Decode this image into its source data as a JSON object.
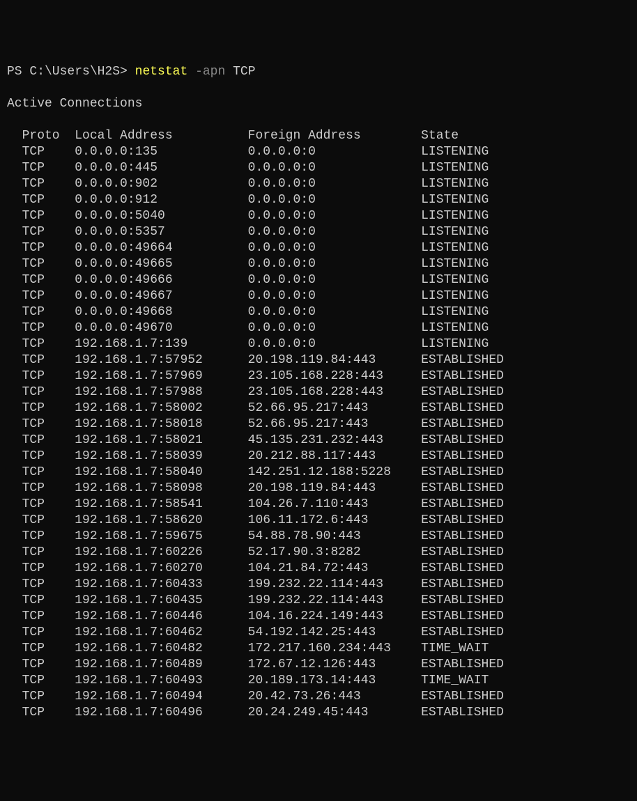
{
  "prompt": {
    "prefix": "PS C:\\Users\\H2S> ",
    "command": "netstat",
    "flag": "-apn",
    "arg": "TCP"
  },
  "section_title": "Active Connections",
  "columns": {
    "proto": "Proto",
    "local": "Local Address",
    "foreign": "Foreign Address",
    "state": "State"
  },
  "rows": [
    {
      "proto": "TCP",
      "local": "0.0.0.0:135",
      "foreign": "0.0.0.0:0",
      "state": "LISTENING"
    },
    {
      "proto": "TCP",
      "local": "0.0.0.0:445",
      "foreign": "0.0.0.0:0",
      "state": "LISTENING"
    },
    {
      "proto": "TCP",
      "local": "0.0.0.0:902",
      "foreign": "0.0.0.0:0",
      "state": "LISTENING"
    },
    {
      "proto": "TCP",
      "local": "0.0.0.0:912",
      "foreign": "0.0.0.0:0",
      "state": "LISTENING"
    },
    {
      "proto": "TCP",
      "local": "0.0.0.0:5040",
      "foreign": "0.0.0.0:0",
      "state": "LISTENING"
    },
    {
      "proto": "TCP",
      "local": "0.0.0.0:5357",
      "foreign": "0.0.0.0:0",
      "state": "LISTENING"
    },
    {
      "proto": "TCP",
      "local": "0.0.0.0:49664",
      "foreign": "0.0.0.0:0",
      "state": "LISTENING"
    },
    {
      "proto": "TCP",
      "local": "0.0.0.0:49665",
      "foreign": "0.0.0.0:0",
      "state": "LISTENING"
    },
    {
      "proto": "TCP",
      "local": "0.0.0.0:49666",
      "foreign": "0.0.0.0:0",
      "state": "LISTENING"
    },
    {
      "proto": "TCP",
      "local": "0.0.0.0:49667",
      "foreign": "0.0.0.0:0",
      "state": "LISTENING"
    },
    {
      "proto": "TCP",
      "local": "0.0.0.0:49668",
      "foreign": "0.0.0.0:0",
      "state": "LISTENING"
    },
    {
      "proto": "TCP",
      "local": "0.0.0.0:49670",
      "foreign": "0.0.0.0:0",
      "state": "LISTENING"
    },
    {
      "proto": "TCP",
      "local": "192.168.1.7:139",
      "foreign": "0.0.0.0:0",
      "state": "LISTENING"
    },
    {
      "proto": "TCP",
      "local": "192.168.1.7:57952",
      "foreign": "20.198.119.84:443",
      "state": "ESTABLISHED"
    },
    {
      "proto": "TCP",
      "local": "192.168.1.7:57969",
      "foreign": "23.105.168.228:443",
      "state": "ESTABLISHED"
    },
    {
      "proto": "TCP",
      "local": "192.168.1.7:57988",
      "foreign": "23.105.168.228:443",
      "state": "ESTABLISHED"
    },
    {
      "proto": "TCP",
      "local": "192.168.1.7:58002",
      "foreign": "52.66.95.217:443",
      "state": "ESTABLISHED"
    },
    {
      "proto": "TCP",
      "local": "192.168.1.7:58018",
      "foreign": "52.66.95.217:443",
      "state": "ESTABLISHED"
    },
    {
      "proto": "TCP",
      "local": "192.168.1.7:58021",
      "foreign": "45.135.231.232:443",
      "state": "ESTABLISHED"
    },
    {
      "proto": "TCP",
      "local": "192.168.1.7:58039",
      "foreign": "20.212.88.117:443",
      "state": "ESTABLISHED"
    },
    {
      "proto": "TCP",
      "local": "192.168.1.7:58040",
      "foreign": "142.251.12.188:5228",
      "state": "ESTABLISHED"
    },
    {
      "proto": "TCP",
      "local": "192.168.1.7:58098",
      "foreign": "20.198.119.84:443",
      "state": "ESTABLISHED"
    },
    {
      "proto": "TCP",
      "local": "192.168.1.7:58541",
      "foreign": "104.26.7.110:443",
      "state": "ESTABLISHED"
    },
    {
      "proto": "TCP",
      "local": "192.168.1.7:58620",
      "foreign": "106.11.172.6:443",
      "state": "ESTABLISHED"
    },
    {
      "proto": "TCP",
      "local": "192.168.1.7:59675",
      "foreign": "54.88.78.90:443",
      "state": "ESTABLISHED"
    },
    {
      "proto": "TCP",
      "local": "192.168.1.7:60226",
      "foreign": "52.17.90.3:8282",
      "state": "ESTABLISHED"
    },
    {
      "proto": "TCP",
      "local": "192.168.1.7:60270",
      "foreign": "104.21.84.72:443",
      "state": "ESTABLISHED"
    },
    {
      "proto": "TCP",
      "local": "192.168.1.7:60433",
      "foreign": "199.232.22.114:443",
      "state": "ESTABLISHED"
    },
    {
      "proto": "TCP",
      "local": "192.168.1.7:60435",
      "foreign": "199.232.22.114:443",
      "state": "ESTABLISHED"
    },
    {
      "proto": "TCP",
      "local": "192.168.1.7:60446",
      "foreign": "104.16.224.149:443",
      "state": "ESTABLISHED"
    },
    {
      "proto": "TCP",
      "local": "192.168.1.7:60462",
      "foreign": "54.192.142.25:443",
      "state": "ESTABLISHED"
    },
    {
      "proto": "TCP",
      "local": "192.168.1.7:60482",
      "foreign": "172.217.160.234:443",
      "state": "TIME_WAIT"
    },
    {
      "proto": "TCP",
      "local": "192.168.1.7:60489",
      "foreign": "172.67.12.126:443",
      "state": "ESTABLISHED"
    },
    {
      "proto": "TCP",
      "local": "192.168.1.7:60493",
      "foreign": "20.189.173.14:443",
      "state": "TIME_WAIT"
    },
    {
      "proto": "TCP",
      "local": "192.168.1.7:60494",
      "foreign": "20.42.73.26:443",
      "state": "ESTABLISHED"
    },
    {
      "proto": "TCP",
      "local": "192.168.1.7:60496",
      "foreign": "20.24.249.45:443",
      "state": "ESTABLISHED"
    }
  ]
}
